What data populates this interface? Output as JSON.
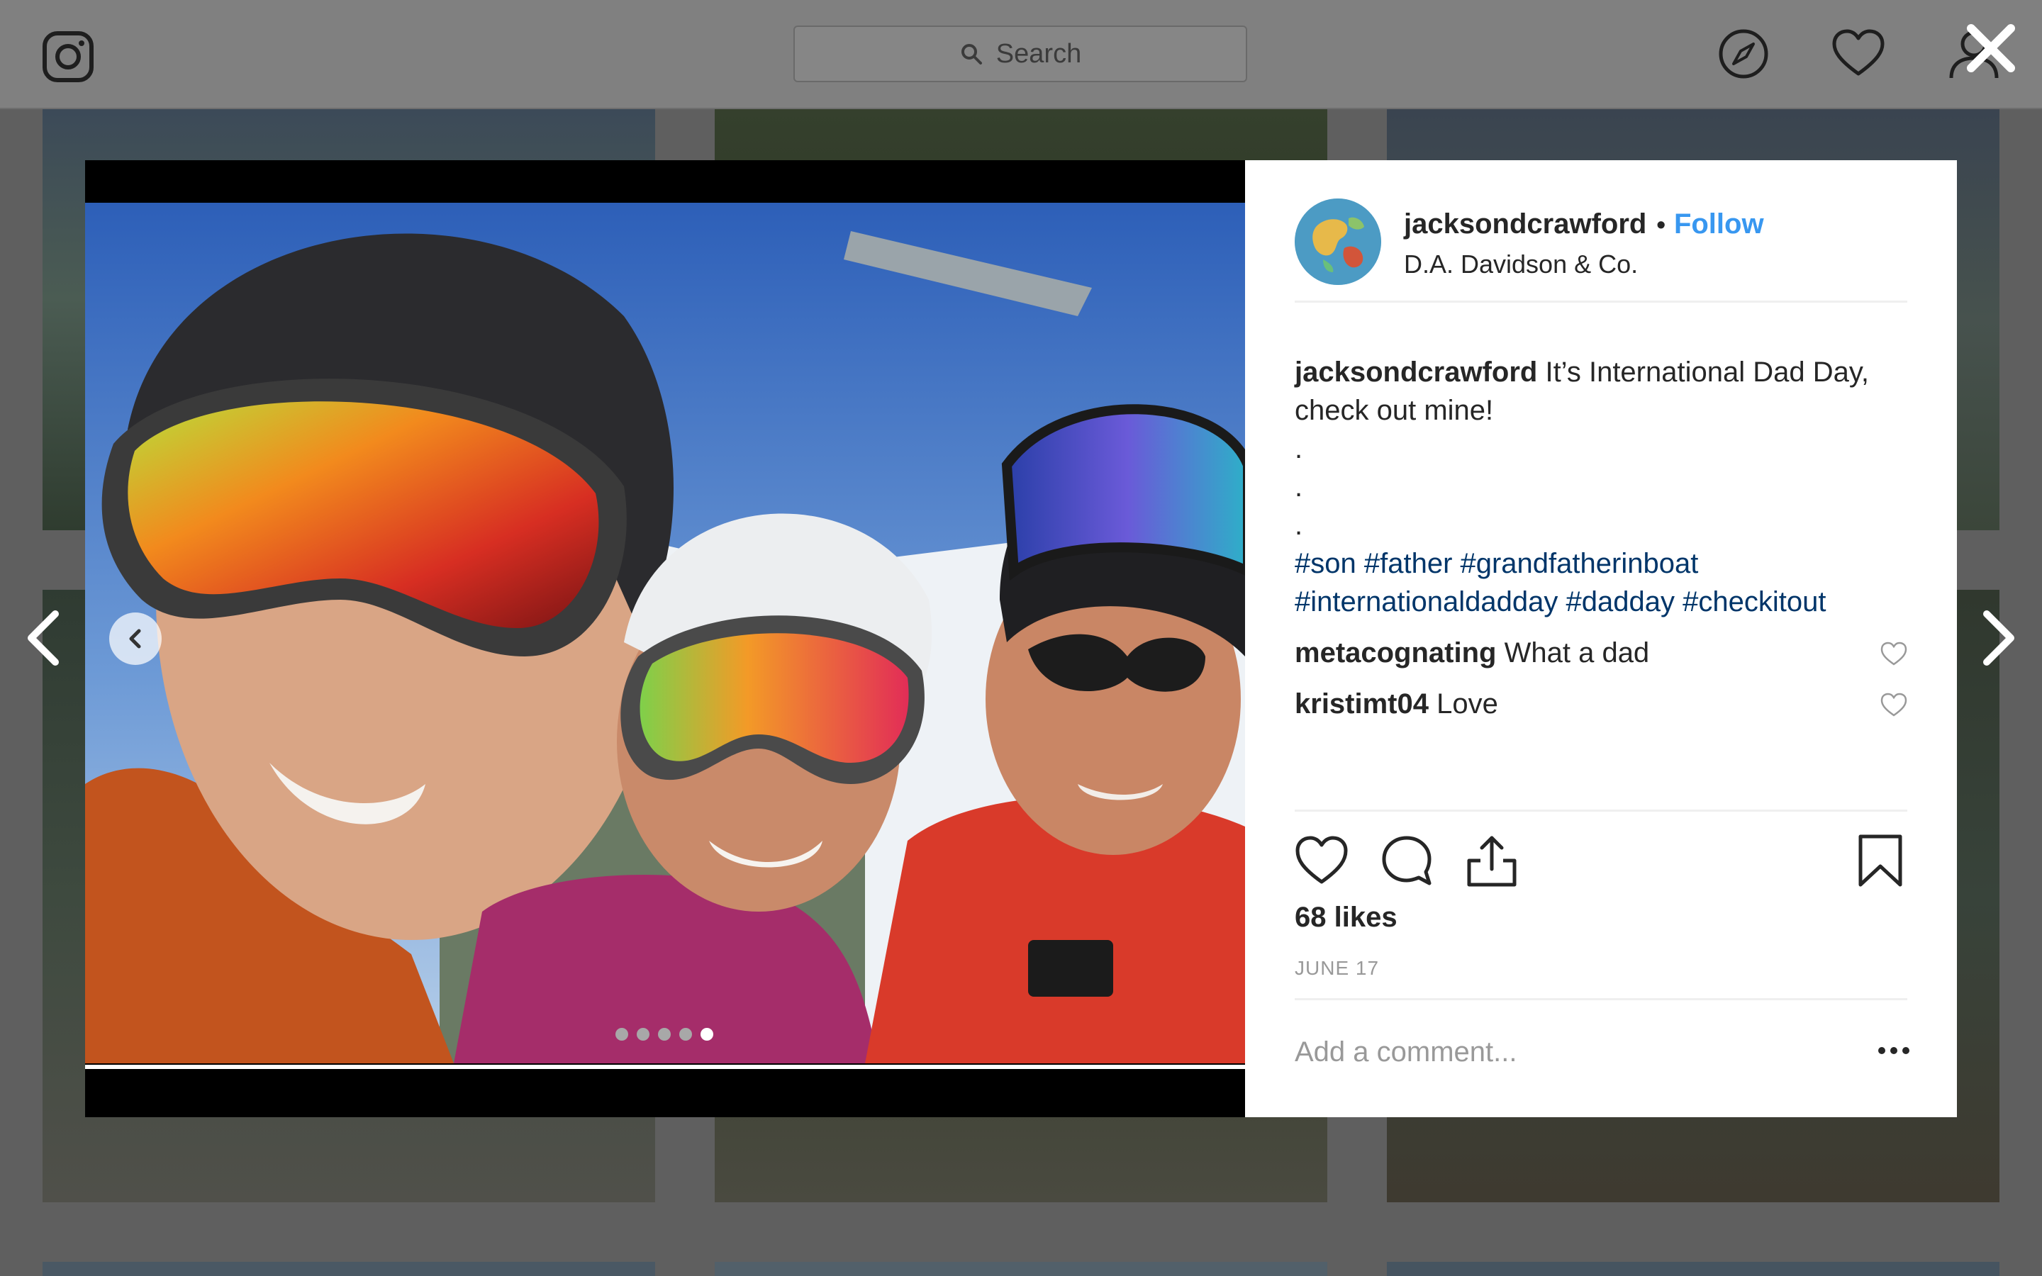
{
  "search": {
    "placeholder": "Search"
  },
  "post": {
    "username": "jacksondcrawford",
    "bullet": "•",
    "follow_label": "Follow",
    "location": "D.A. Davidson & Co.",
    "caption": {
      "text": "It’s International Dad Day, check out mine!",
      "dots": [
        ".",
        ".",
        "."
      ],
      "hashtags_line1": "#son #father #grandfatherinboat",
      "hashtags_line2": "#internationaldadday #dadday #checkitout"
    },
    "comments": [
      {
        "user": "metacognating",
        "text": "What a dad"
      },
      {
        "user": "kristimt04",
        "text": "Love"
      }
    ],
    "likes": "68 likes",
    "date": "JUNE 17",
    "add_comment_placeholder": "Add a comment...",
    "carousel": {
      "total": 5,
      "active_index": 4
    }
  },
  "icons": {
    "topbar": [
      "instagram-icon",
      "search-icon",
      "explore-compass-icon",
      "activity-heart-icon",
      "profile-icon",
      "close-icon"
    ],
    "actions": [
      "like-heart-icon",
      "comment-bubble-icon",
      "share-icon",
      "bookmark-icon"
    ]
  },
  "colors": {
    "follow": "#3897f0",
    "hashtag": "#003569",
    "overlay": "#5f5f5f"
  }
}
